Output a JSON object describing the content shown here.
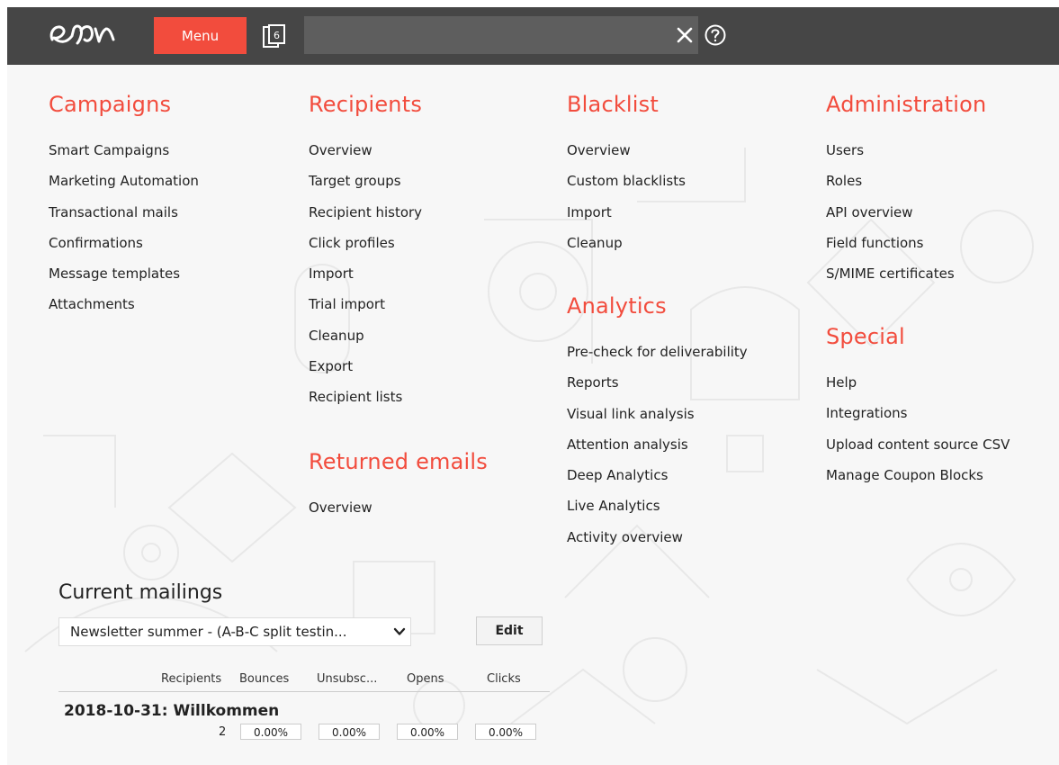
{
  "header": {
    "menu_label": "Menu",
    "tab_count": "6",
    "search_value": "",
    "logo_icon": "epi-logo",
    "tabs_icon": "tabs-icon",
    "clear_icon": "close-icon",
    "help_icon": "help-icon"
  },
  "colors": {
    "accent": "#f24c3d",
    "topbar": "#464646",
    "search_bg": "#5e5e5e",
    "background": "#f7f7f7"
  },
  "campaigns": {
    "title": "Campaigns",
    "items": [
      "Smart Campaigns",
      "Marketing Automation",
      "Transactional mails",
      "Confirmations",
      "Message templates",
      "Attachments"
    ]
  },
  "recipients": {
    "title": "Recipients",
    "items": [
      "Overview",
      "Target groups",
      "Recipient history",
      "Click profiles",
      "Import",
      "Trial import",
      "Cleanup",
      "Export",
      "Recipient lists"
    ]
  },
  "returned_emails": {
    "title": "Returned emails",
    "items": [
      "Overview"
    ]
  },
  "blacklist": {
    "title": "Blacklist",
    "items": [
      "Overview",
      "Custom blacklists",
      "Import",
      "Cleanup"
    ]
  },
  "analytics": {
    "title": "Analytics",
    "items": [
      "Pre-check for deliverability",
      "Reports",
      "Visual link analysis",
      "Attention analysis",
      "Deep Analytics",
      "Live Analytics",
      "Activity overview"
    ]
  },
  "administration": {
    "title": "Administration",
    "items": [
      "Users",
      "Roles",
      "API overview",
      "Field functions",
      "S/MIME certificates"
    ]
  },
  "special": {
    "title": "Special",
    "items": [
      "Help",
      "Integrations",
      "Upload content source CSV",
      "Manage Coupon Blocks"
    ]
  },
  "current_mailings": {
    "title": "Current mailings",
    "selected": "Newsletter summer - (A-B-C split testin...",
    "edit_label": "Edit",
    "columns": [
      "Recipients",
      "Bounces",
      "Unsubsc...",
      "Opens",
      "Clicks"
    ],
    "mailing_title": "2018-10-31: Willkommen",
    "recipients": "2",
    "bounces": "0.00%",
    "unsubscribes": "0.00%",
    "opens": "0.00%",
    "clicks": "0.00%"
  }
}
